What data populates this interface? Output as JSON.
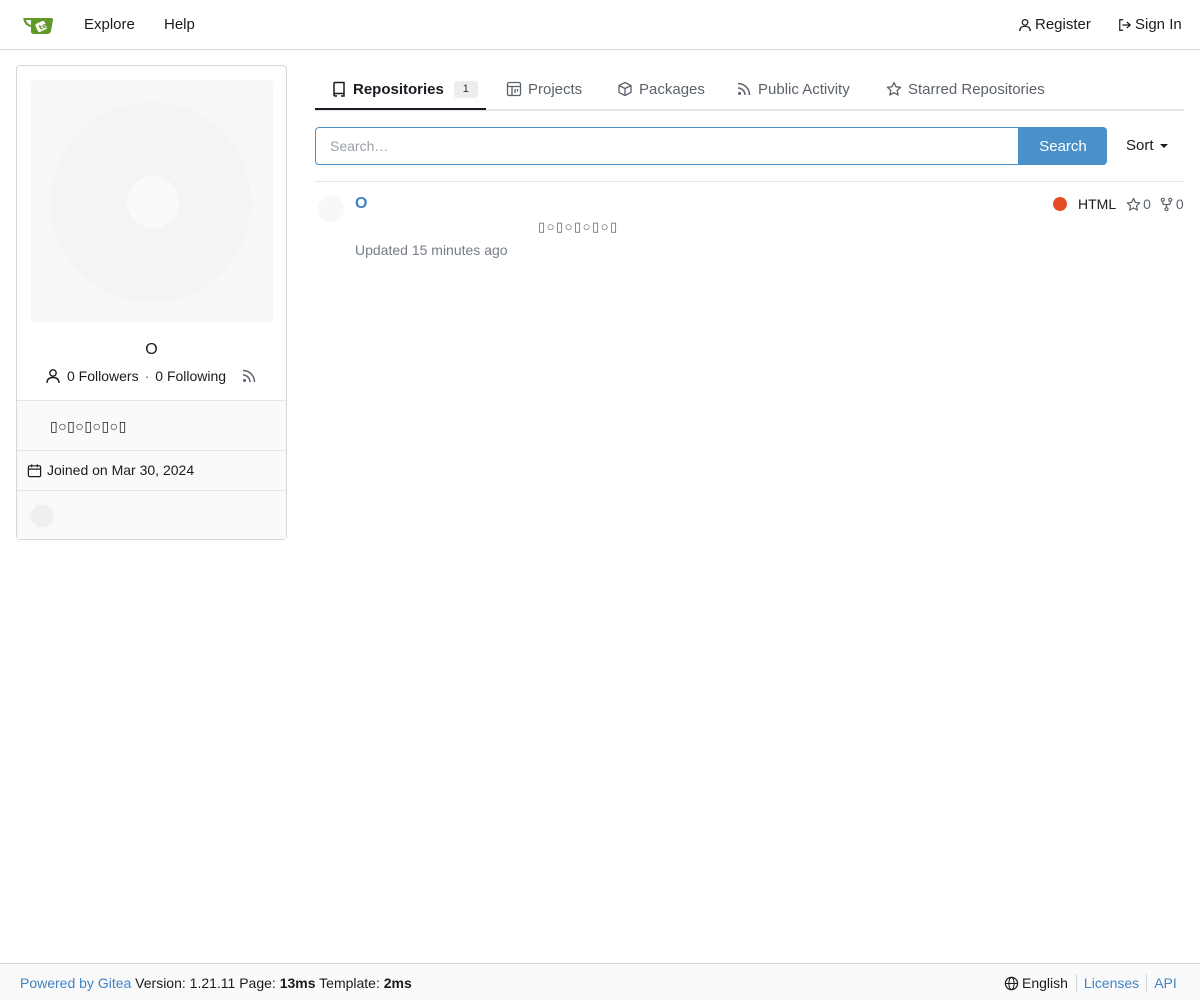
{
  "navbar": {
    "explore": "Explore",
    "help": "Help",
    "register": "Register",
    "signin": "Sign In"
  },
  "profile": {
    "name": "O",
    "followers": "0 Followers",
    "separator": "·",
    "following": "0 Following",
    "description": "▯○▯○▯○▯○▯",
    "joined": "Joined on Mar 30, 2024"
  },
  "tabs": {
    "repositories": "Repositories",
    "repositories_count": "1",
    "projects": "Projects",
    "packages": "Packages",
    "public_activity": "Public Activity",
    "starred": "Starred Repositories"
  },
  "search": {
    "placeholder": "Search…",
    "button": "Search",
    "sort": "Sort"
  },
  "repos": [
    {
      "name": "O",
      "description": "▯○▯○▯○▯○▯",
      "updated": "Updated 15 minutes ago",
      "language": "HTML",
      "language_color": "#e34c26",
      "stars": "0",
      "forks": "0"
    }
  ],
  "footer": {
    "powered_by": "Powered by Gitea",
    "version": " Version: 1.21.11 Page: ",
    "page_time": "13ms",
    "template_label": " Template: ",
    "template_time": "2ms",
    "language": "English",
    "licenses": "Licenses",
    "api": "API"
  },
  "colors": {
    "primary": "#4a90c9",
    "link": "#4183c4",
    "border": "#d0d7de"
  },
  "icons": [
    "gitea-logo-icon",
    "person-icon",
    "sign-in-icon",
    "rss-icon",
    "calendar-icon",
    "repo-icon",
    "project-icon",
    "package-icon",
    "pulse-icon",
    "star-icon",
    "fork-icon",
    "globe-icon"
  ]
}
